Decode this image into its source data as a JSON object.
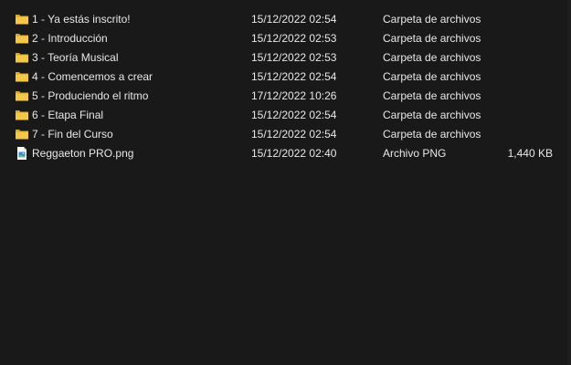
{
  "rows": [
    {
      "name": "1 - Ya estás inscrito!",
      "date": "15/12/2022 02:54",
      "type": "Carpeta de archivos",
      "size": "",
      "icon": "folder-icon"
    },
    {
      "name": "2 - Introducción",
      "date": "15/12/2022 02:53",
      "type": "Carpeta de archivos",
      "size": "",
      "icon": "folder-icon"
    },
    {
      "name": "3 - Teoría Musical",
      "date": "15/12/2022 02:53",
      "type": "Carpeta de archivos",
      "size": "",
      "icon": "folder-icon"
    },
    {
      "name": "4 - Comencemos a crear",
      "date": "15/12/2022 02:54",
      "type": "Carpeta de archivos",
      "size": "",
      "icon": "folder-icon"
    },
    {
      "name": "5 - Produciendo el ritmo",
      "date": "17/12/2022 10:26",
      "type": "Carpeta de archivos",
      "size": "",
      "icon": "folder-icon"
    },
    {
      "name": "6 - Etapa Final",
      "date": "15/12/2022 02:54",
      "type": "Carpeta de archivos",
      "size": "",
      "icon": "folder-icon"
    },
    {
      "name": "7 - Fin del Curso",
      "date": "15/12/2022 02:54",
      "type": "Carpeta de archivos",
      "size": "",
      "icon": "folder-icon"
    },
    {
      "name": "Reggaeton PRO.png",
      "date": "15/12/2022 02:40",
      "type": "Archivo PNG",
      "size": "1,440 KB",
      "icon": "png-file-icon"
    }
  ],
  "colors": {
    "background": "#191919",
    "text": "#e8e8e8",
    "folder": "#f3c848",
    "folder_shadow": "#d9a823"
  }
}
